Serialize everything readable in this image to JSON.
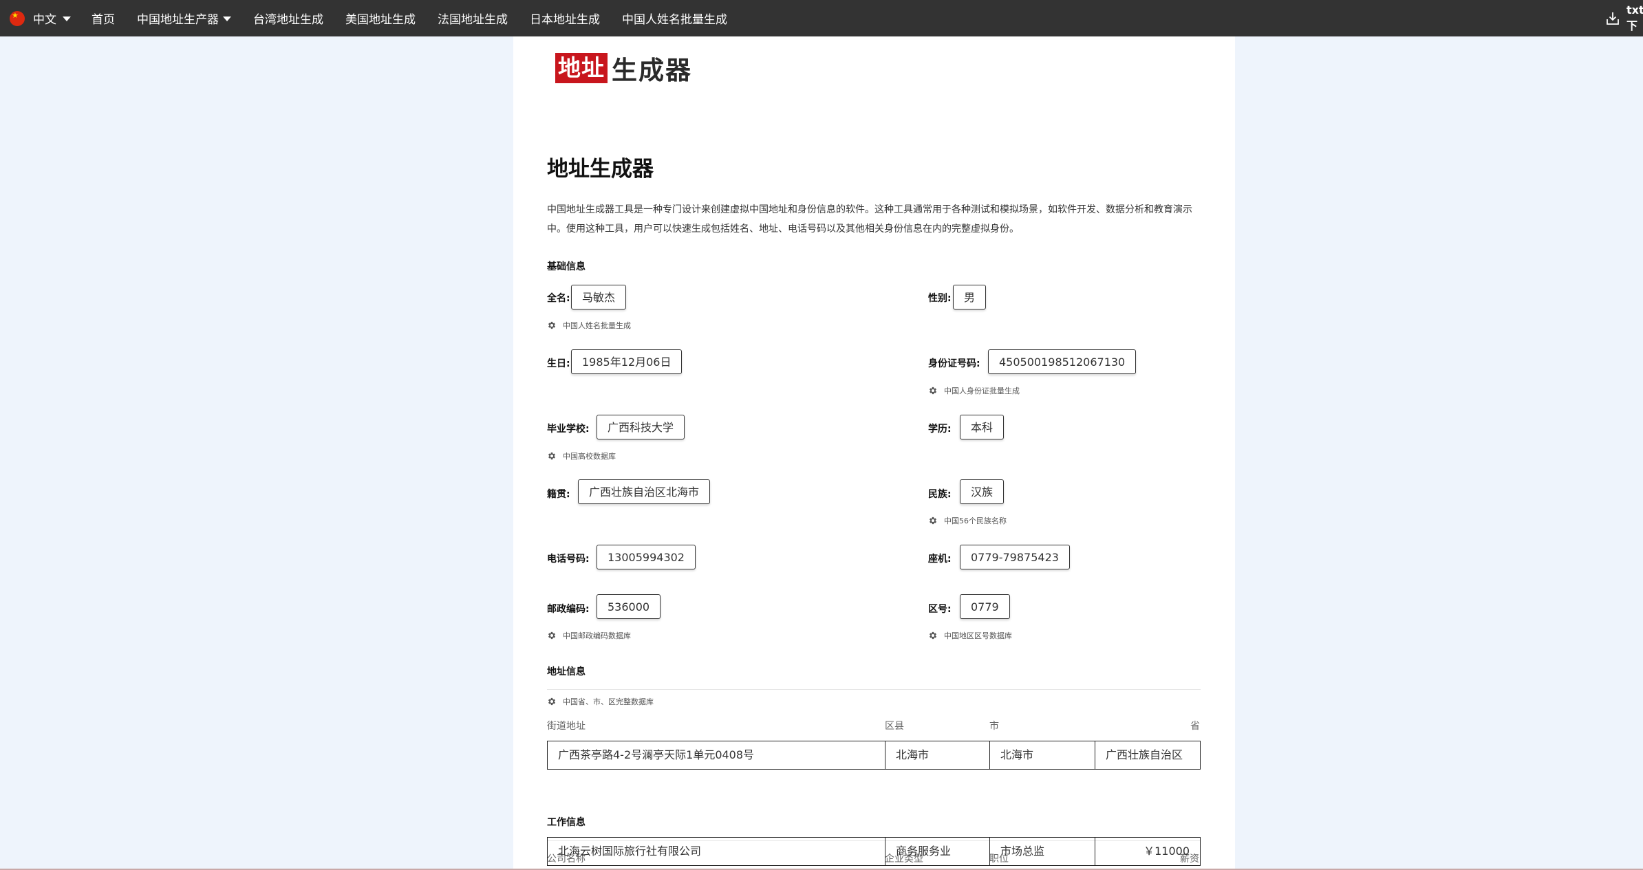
{
  "nav": {
    "lang_label": "中文",
    "items": [
      {
        "label": "首页"
      },
      {
        "label": "中国地址生产器"
      },
      {
        "label": "台湾地址生成"
      },
      {
        "label": "美国地址生成"
      },
      {
        "label": "法国地址生成"
      },
      {
        "label": "日本地址生成"
      },
      {
        "label": "中国人姓名批量生成"
      }
    ],
    "right_label": "txt下",
    "icons": {
      "flag": "china-flag-icon",
      "download": "download-icon"
    }
  },
  "logo": {
    "part1": "地址",
    "part2": "生成器",
    "colors": {
      "red": "#c8161d",
      "dark": "#2a2a2a"
    }
  },
  "page": {
    "title": "地址生成器",
    "intro": "中国地址生成器工具是一种专门设计来创建虚拟中国地址和身份信息的软件。这种工具通常用于各种测试和模拟场景，如软件开发、数据分析和教育演示中。使用这种工具，用户可以快速生成包括姓名、地址、电话号码以及其他相关身份信息在内的完整虚拟身份。"
  },
  "basic": {
    "section_title": "基础信息",
    "name": {
      "label": "全名:",
      "value": "马敏杰",
      "hint": "中国人姓名批量生成"
    },
    "gender": {
      "label": "性别:",
      "value": "男"
    },
    "birthday": {
      "label": "生日:",
      "value": "1985年12月06日"
    },
    "id_card": {
      "label": "身份证号码:",
      "value": "450500198512067130",
      "hint": "中国人身份证批量生成"
    },
    "school": {
      "label": "毕业学校:",
      "value": "广西科技大学",
      "hint": "中国高校数据库"
    },
    "education": {
      "label": "学历:",
      "value": "本科"
    },
    "hometown": {
      "label": "籍贯:",
      "value": "广西壮族自治区北海市"
    },
    "ethnicity": {
      "label": "民族:",
      "value": "汉族",
      "hint": "中国56个民族名称"
    },
    "phone": {
      "label": "电话号码:",
      "value": "13005994302"
    },
    "landline": {
      "label": "座机:",
      "value": "0779-79875423"
    },
    "postcode": {
      "label": "邮政编码:",
      "value": "536000",
      "hint": "中国邮政编码数据库"
    },
    "area_code": {
      "label": "区号:",
      "value": "0779",
      "hint": "中国地区区号数据库"
    }
  },
  "address": {
    "section_title": "地址信息",
    "hint": "中国省、市、区完整数据库",
    "headers": [
      "街道地址",
      "区县",
      "市",
      "省"
    ],
    "row": [
      "广西茶亭路4-2号澜亭天际1单元0408号",
      "北海市",
      "北海市",
      "广西壮族自治区"
    ]
  },
  "work": {
    "section_title": "工作信息",
    "headers": [
      "公司名称",
      "企业类型",
      "职位",
      "薪资"
    ],
    "row": [
      "北海云树国际旅行社有限公司",
      "商务服务业",
      "市场总监",
      "￥11000"
    ]
  }
}
